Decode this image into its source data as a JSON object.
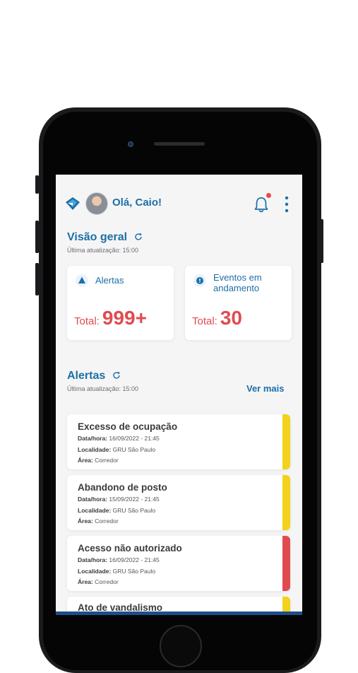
{
  "header": {
    "greeting": "Olá, Caio!",
    "logo_icon": "diamond-logo-icon",
    "notification_icon": "bell-icon",
    "menu_icon": "kebab-menu-icon"
  },
  "overview": {
    "title": "Visão geral",
    "updated": "Última atualização: 15:00",
    "cards": [
      {
        "title": "Alertas",
        "total_label": "Total:",
        "total_value": "999+",
        "icon": "warning-triangle-icon"
      },
      {
        "title_line1": "Eventos em",
        "title_line2": "andamento",
        "total_label": "Total:",
        "total_value": "30",
        "icon": "info-circle-icon"
      }
    ]
  },
  "alerts": {
    "title": "Alertas",
    "updated": "Última atualização: 15:00",
    "see_more": "Ver mais",
    "labels": {
      "datetime": "Data/hora:",
      "location": "Localidade:",
      "area": "Área:"
    },
    "items": [
      {
        "title": "Excesso de ocupação",
        "datetime": "16/09/2022 - 21:45",
        "location": "GRU São Paulo",
        "area": "Corredor",
        "severity_color": "#f2d21b"
      },
      {
        "title": "Abandono de posto",
        "datetime": "15/09/2022 - 21:45",
        "location": "GRU São Paulo",
        "area": "Corredor",
        "severity_color": "#f2d21b"
      },
      {
        "title": "Acesso não autorizado",
        "datetime": "16/09/2022 - 21:45",
        "location": "GRU São Paulo",
        "area": "Corredor",
        "severity_color": "#e04b50"
      },
      {
        "title": "Ato de vandalismo",
        "severity_color": "#f2d21b"
      }
    ]
  },
  "colors": {
    "primary": "#1c6fa6",
    "danger": "#e04b50",
    "warning": "#f2d21b"
  }
}
